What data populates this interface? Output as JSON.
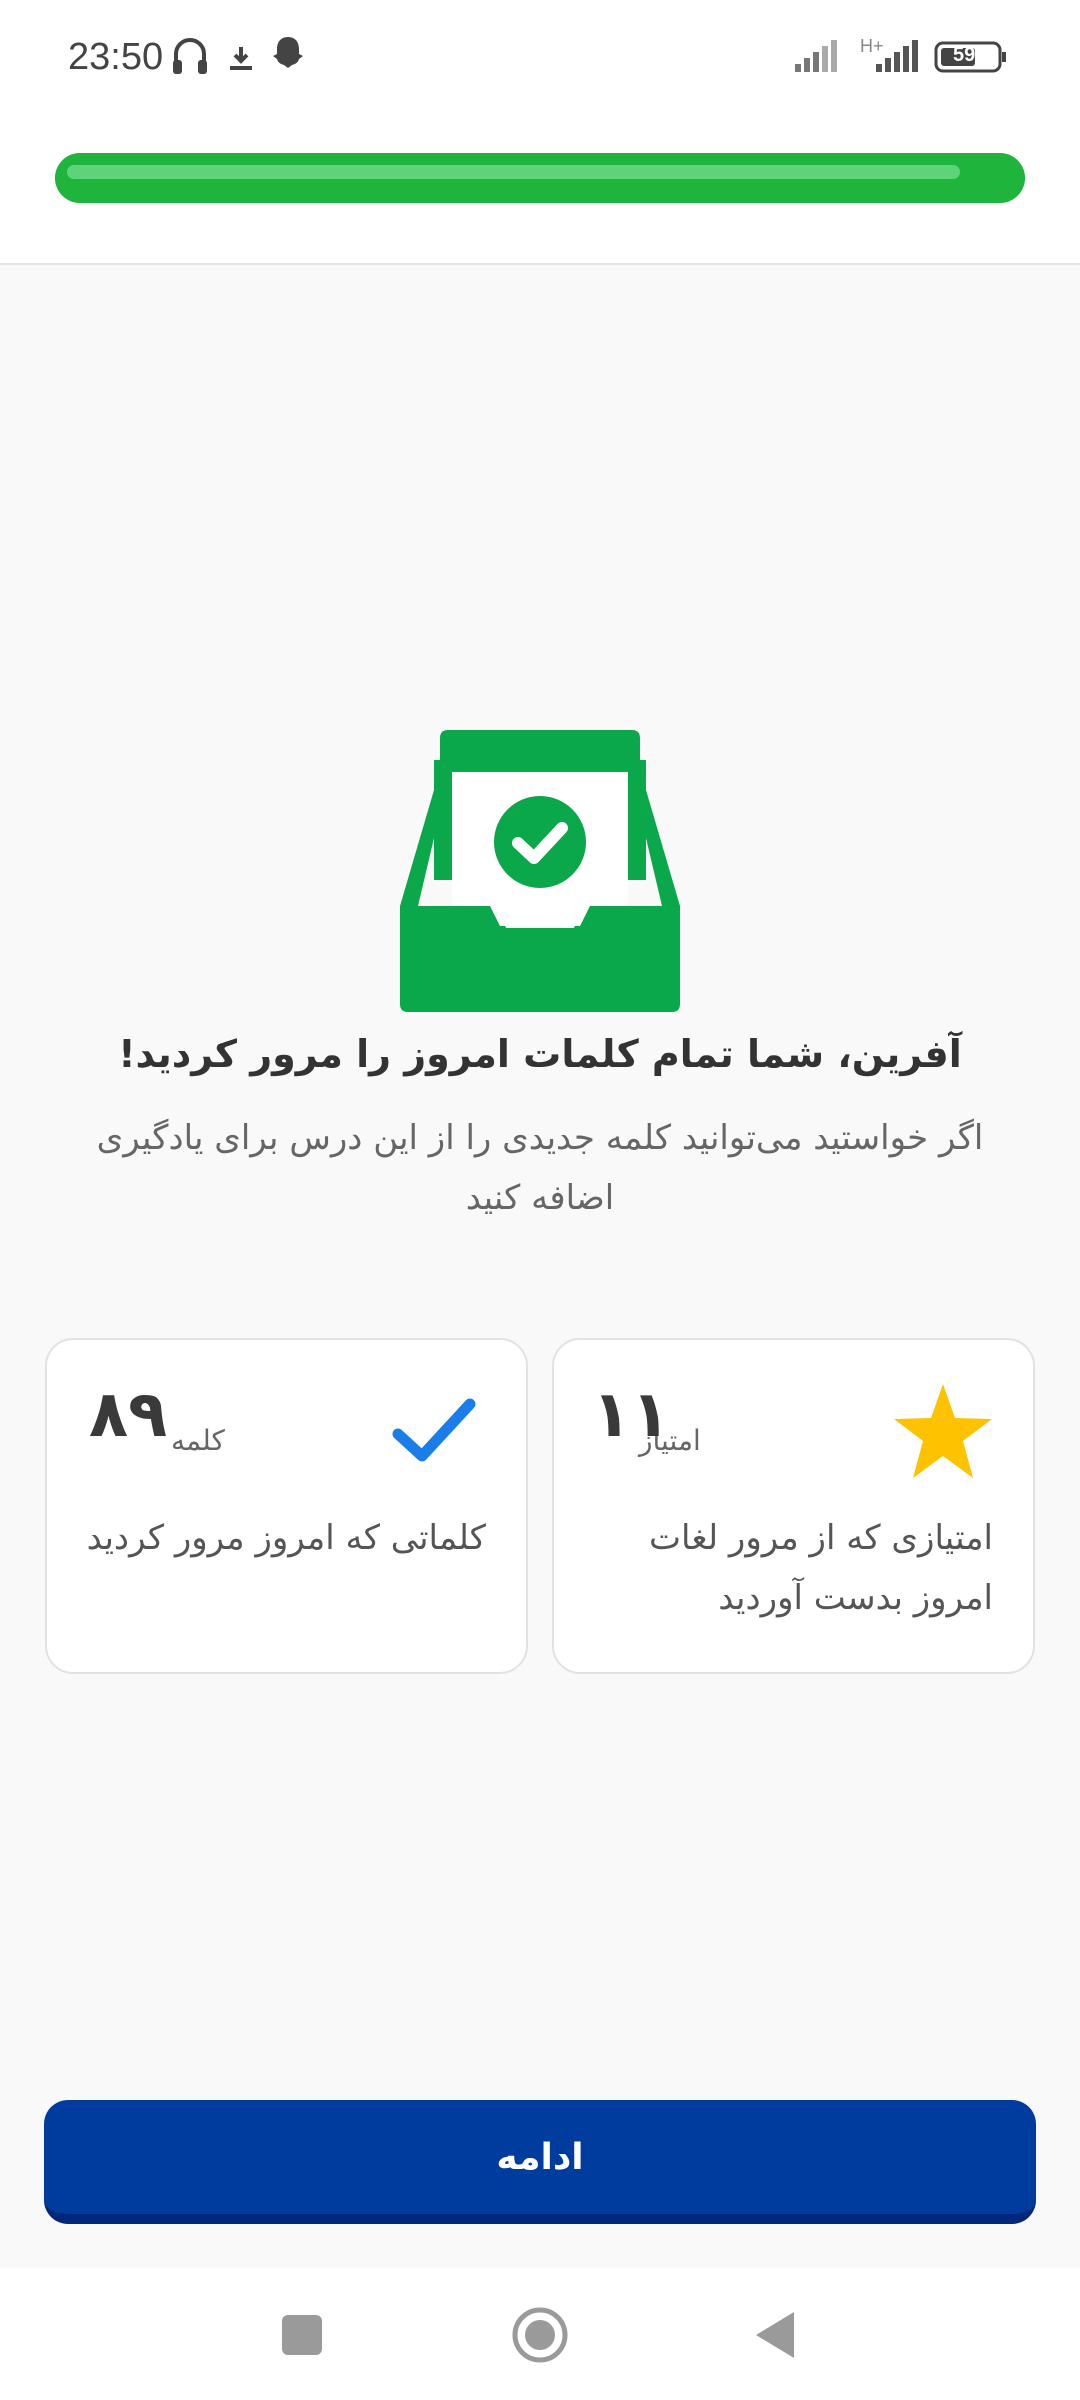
{
  "status_bar": {
    "time": "23:50",
    "battery": "59",
    "network_label": "H+",
    "icons": [
      "headphones-icon",
      "download-icon",
      "snapchat-icon",
      "signal-icon",
      "battery-icon"
    ]
  },
  "progress": {
    "fraction": 1.0
  },
  "illustration": {
    "icon": "inbox-check-icon",
    "color": "#0aa84a"
  },
  "message": {
    "title": "آفرین، شما تمام کلمات امروز را مرور کردید!",
    "subtitle": "اگر خواستید می‌توانید کلمه جدیدی را از این درس برای یادگیری اضافه کنید"
  },
  "stats": {
    "points": {
      "value": "۱۱",
      "unit": "امتیاز",
      "description": "امتیازی که از مرور لغات امروز بدست آوردید",
      "icon": "star-icon",
      "icon_color": "#ffc200"
    },
    "words": {
      "value": "۸۹",
      "unit": "کلمه",
      "description": "کلماتی که امروز مرور کردید",
      "icon": "checkmark-icon",
      "icon_color": "#1a7de8"
    }
  },
  "actions": {
    "continue_label": "ادامه"
  },
  "colors": {
    "primary_button": "#003c9e",
    "progress": "#1fb43c"
  }
}
